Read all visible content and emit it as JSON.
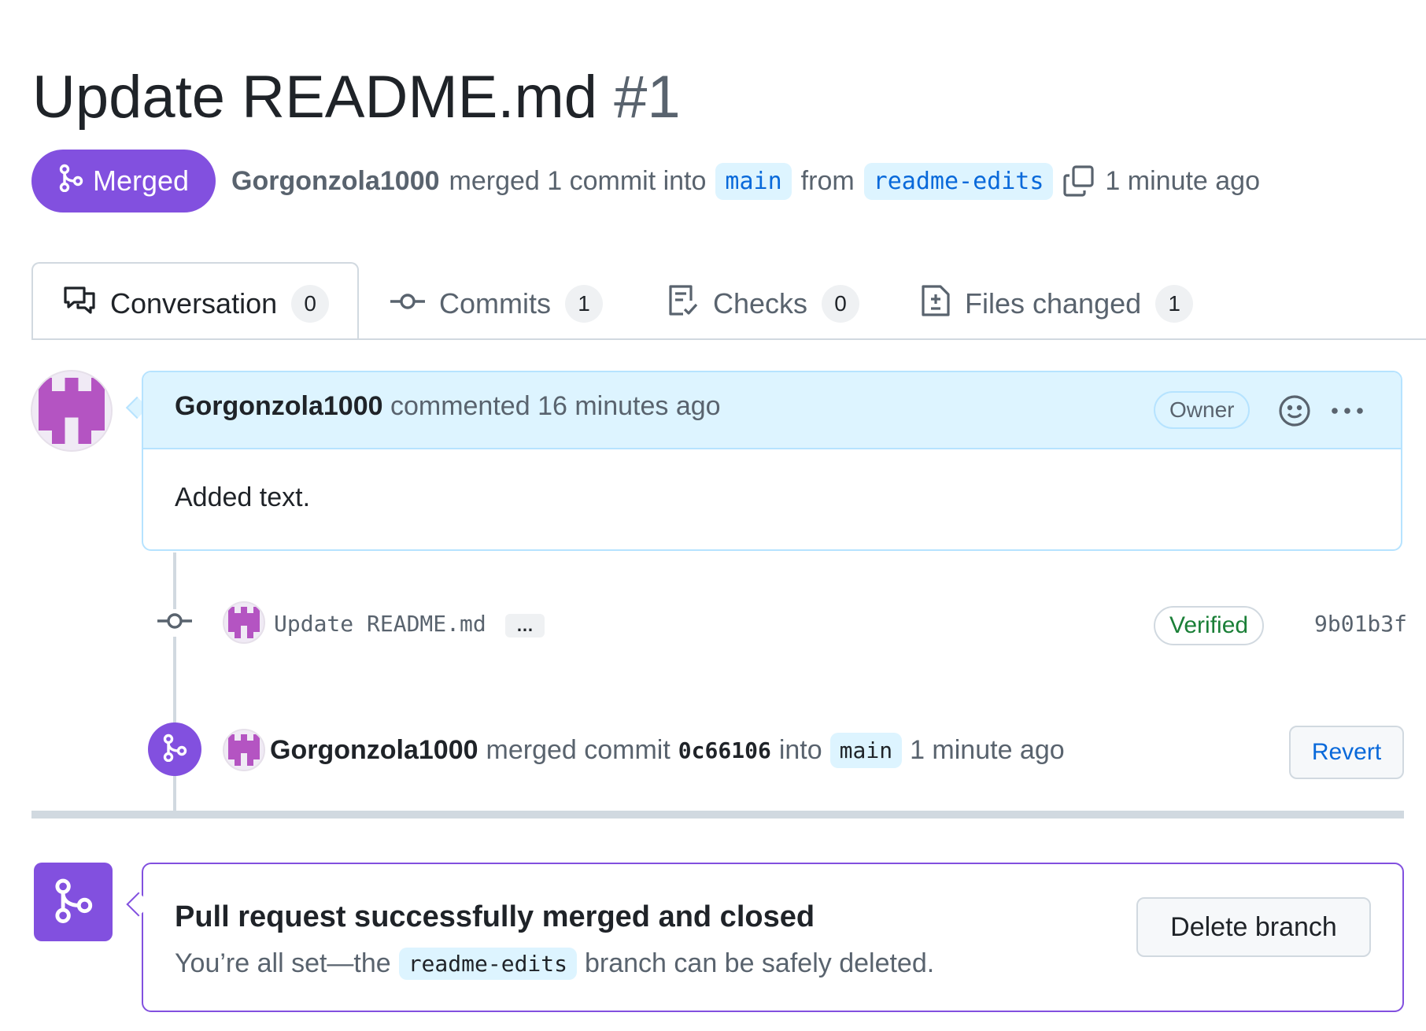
{
  "pr": {
    "title": "Update README.md",
    "number": "#1",
    "state_label": "Merged",
    "author": "Gorgonzola1000",
    "merged_text": "merged 1 commit into",
    "base_branch": "main",
    "from_text": "from",
    "head_branch": "readme-edits",
    "time_ago": "1 minute ago"
  },
  "tabs": [
    {
      "label": "Conversation",
      "count": "0",
      "icon": "comment-discussion-icon"
    },
    {
      "label": "Commits",
      "count": "1",
      "icon": "git-commit-icon"
    },
    {
      "label": "Checks",
      "count": "0",
      "icon": "checklist-icon"
    },
    {
      "label": "Files changed",
      "count": "1",
      "icon": "file-diff-icon"
    }
  ],
  "comment": {
    "author": "Gorgonzola1000",
    "action": "commented",
    "time_ago": "16 minutes ago",
    "role_badge": "Owner",
    "body": "Added text."
  },
  "commit": {
    "message": "Update README.md",
    "ellipsis": "…",
    "verified_label": "Verified",
    "sha": "9b01b3f"
  },
  "merge_event": {
    "author": "Gorgonzola1000",
    "action": "merged commit",
    "commit_id": "0c66106",
    "into_text": "into",
    "branch": "main",
    "time_ago": "1 minute ago",
    "revert_label": "Revert"
  },
  "merge_status": {
    "heading": "Pull request successfully merged and closed",
    "desc_prefix": "You’re all set—the",
    "branch": "readme-edits",
    "desc_suffix": "branch can be safely deleted.",
    "delete_label": "Delete branch"
  },
  "colors": {
    "merged_purple": "#8250df",
    "link_blue": "#0969da",
    "verified_green": "#1a7f37",
    "header_blue": "#ddf4ff"
  }
}
